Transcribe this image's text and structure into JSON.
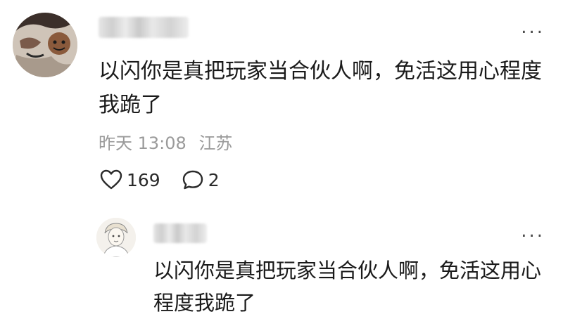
{
  "comment": {
    "text": "以闪你是真把玩家当合伙人啊，免活这用心程度我跪了",
    "time": "昨天 13:08",
    "location": "江苏",
    "likes": "169",
    "replies": "2",
    "more_label": "..."
  },
  "reply": {
    "text": "以闪你是真把玩家当合伙人啊，免活这用心程度我跪了",
    "more_label": "..."
  },
  "icons": {
    "like": "heart-outline-icon",
    "reply": "speech-bubble-icon"
  },
  "colors": {
    "meta_text": "#9a9a9a",
    "body_text": "#1a1a1a"
  }
}
